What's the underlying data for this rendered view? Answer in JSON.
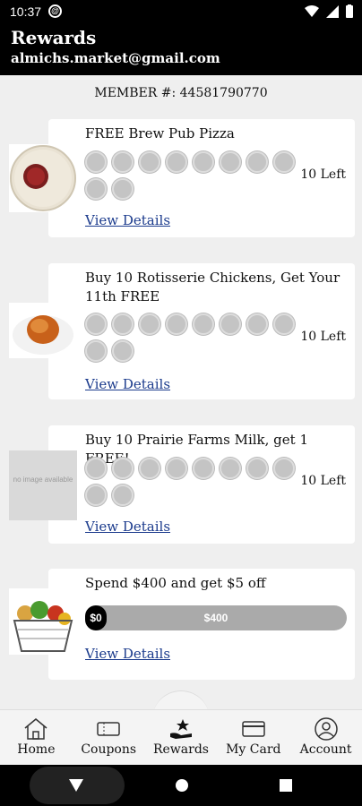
{
  "status_bar": {
    "time": "10:37"
  },
  "header": {
    "title": "Rewards",
    "email": "almichs.market@gmail.com"
  },
  "member": {
    "text": "MEMBER #: 44581790770"
  },
  "cards": [
    {
      "title": "FREE Brew Pub Pizza",
      "left": "10 Left",
      "link": "View Details",
      "stamps_total": 10,
      "image": "pizza"
    },
    {
      "title": "Buy 10 Rotisserie Chickens, Get Your 11th FREE",
      "left": "10 Left",
      "link": "View Details",
      "stamps_total": 10,
      "image": "chicken"
    },
    {
      "title": "Buy 10 Prairie Farms Milk, get 1 FREE!",
      "left": "10 Left",
      "link": "View Details",
      "stamps_total": 10,
      "image": "no-image",
      "placeholder": "no image available"
    },
    {
      "title": "Spend $400 and get $5 off",
      "link": "View Details",
      "progress_start": "$0",
      "progress_end": "$400",
      "progress_fraction": 0,
      "image": "grocery-basket"
    }
  ],
  "nav": [
    {
      "label": "Home",
      "icon": "home-icon"
    },
    {
      "label": "Coupons",
      "icon": "coupon-icon"
    },
    {
      "label": "Rewards",
      "icon": "rewards-icon"
    },
    {
      "label": "My Card",
      "icon": "card-icon"
    },
    {
      "label": "Account",
      "icon": "account-icon"
    }
  ],
  "colors": {
    "header_bg": "#000000",
    "link": "#1a3a8c",
    "stamp": "#c4c4c4"
  }
}
